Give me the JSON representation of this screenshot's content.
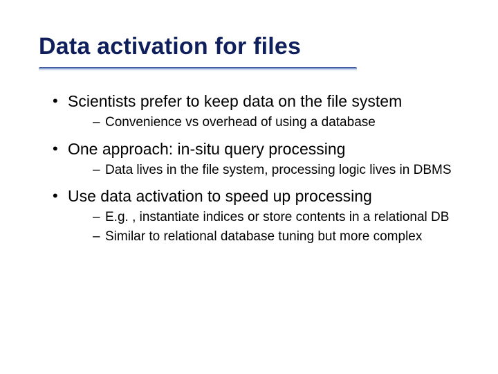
{
  "title": "Data activation for files",
  "bullets": [
    {
      "text": "Scientists prefer to keep data on the file system",
      "sub": [
        "Convenience vs overhead of using a database"
      ]
    },
    {
      "text": "One approach: in-situ query processing",
      "sub": [
        "Data lives in the file system, processing logic lives in DBMS"
      ]
    },
    {
      "text": "Use data activation to speed up processing",
      "sub": [
        "E.g. , instantiate indices or store contents in a relational DB",
        "Similar to relational database tuning but more complex"
      ]
    }
  ]
}
